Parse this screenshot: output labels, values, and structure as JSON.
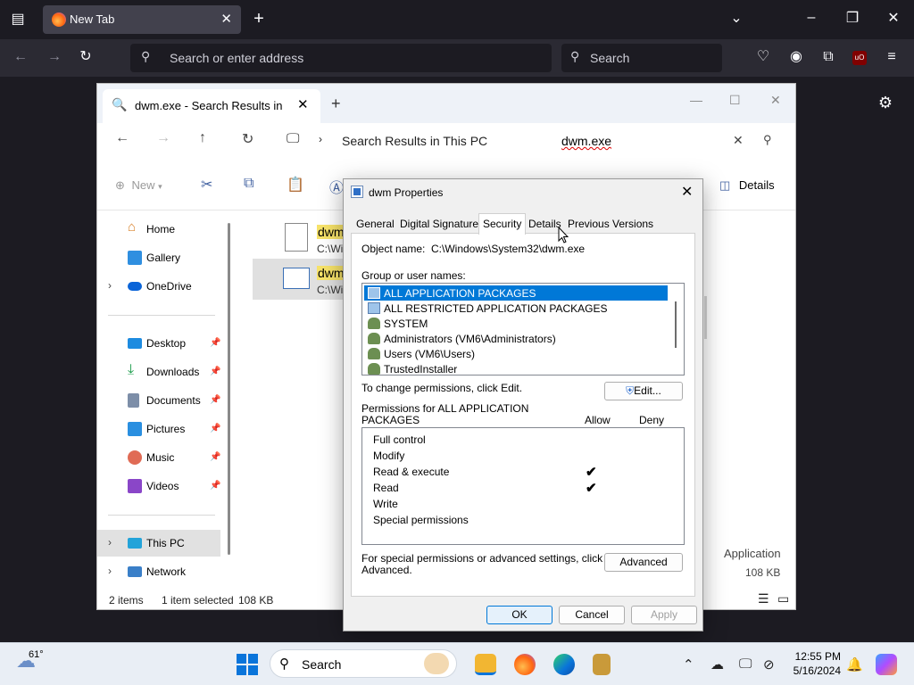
{
  "firefox": {
    "tab_title": "New Tab",
    "url_placeholder": "Search or enter address",
    "search_placeholder": "Search"
  },
  "explorer": {
    "tab_title": "dwm.exe - Search Results in Sy",
    "address": "Search Results in This PC",
    "search_value": "dwm.exe",
    "toolbar": {
      "new_label": "New",
      "details_label": "Details"
    },
    "sidebar": {
      "top": [
        {
          "label": "Home"
        },
        {
          "label": "Gallery"
        },
        {
          "label": "OneDrive"
        }
      ],
      "pinned": [
        {
          "label": "Desktop"
        },
        {
          "label": "Downloads"
        },
        {
          "label": "Documents"
        },
        {
          "label": "Pictures"
        },
        {
          "label": "Music"
        },
        {
          "label": "Videos"
        }
      ],
      "bottom": [
        {
          "label": "This PC"
        },
        {
          "label": "Network"
        }
      ]
    },
    "files": [
      {
        "name": "dwm",
        "path": "C:\\Wi"
      },
      {
        "name": "dwm",
        "path": "C:\\Wi"
      }
    ],
    "details_type": "Application",
    "details_size": "108 KB",
    "status": {
      "items": "2 items",
      "selected": "1 item selected",
      "size": "108 KB"
    }
  },
  "dialog": {
    "title": "dwm Properties",
    "tabs": [
      "General",
      "Digital Signatures",
      "Security",
      "Details",
      "Previous Versions"
    ],
    "object_name_label": "Object name:",
    "object_name_value": "C:\\Windows\\System32\\dwm.exe",
    "group_label": "Group or user names:",
    "users": [
      {
        "name": "ALL APPLICATION PACKAGES",
        "selected": true
      },
      {
        "name": "ALL RESTRICTED APPLICATION PACKAGES",
        "selected": false
      },
      {
        "name": "SYSTEM",
        "selected": false
      },
      {
        "name": "Administrators (VM6\\Administrators)",
        "selected": false
      },
      {
        "name": "Users (VM6\\Users)",
        "selected": false
      },
      {
        "name": "TrustedInstaller",
        "selected": false
      }
    ],
    "change_text": "To change permissions, click Edit.",
    "edit_label": "Edit...",
    "perm_header_1": "Permissions for ALL APPLICATION",
    "perm_header_2": "PACKAGES",
    "allow_label": "Allow",
    "deny_label": "Deny",
    "permissions": [
      {
        "name": "Full control",
        "allow": false
      },
      {
        "name": "Modify",
        "allow": false
      },
      {
        "name": "Read & execute",
        "allow": true
      },
      {
        "name": "Read",
        "allow": true
      },
      {
        "name": "Write",
        "allow": false
      },
      {
        "name": "Special permissions",
        "allow": false
      }
    ],
    "special_text_1": "For special permissions or advanced settings, click",
    "special_text_2": "Advanced.",
    "advanced_label": "Advanced",
    "ok_label": "OK",
    "cancel_label": "Cancel",
    "apply_label": "Apply"
  },
  "taskbar": {
    "weather": "61°",
    "search_placeholder": "Search",
    "time": "12:55 PM",
    "date": "5/16/2024"
  },
  "colors": {
    "selection": "#0078d7",
    "highlight": "#f7e36a"
  }
}
